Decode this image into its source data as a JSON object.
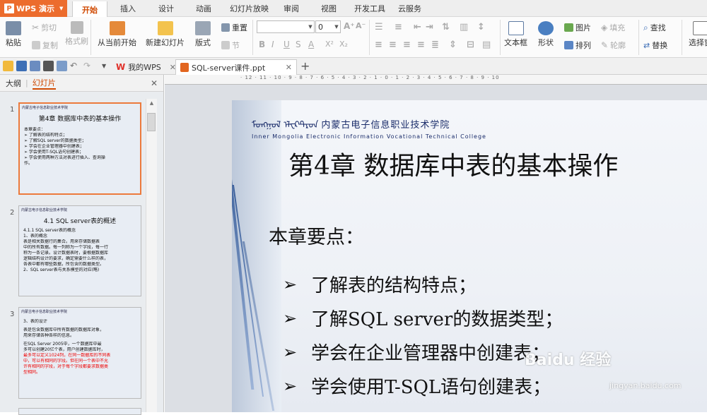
{
  "app": {
    "name": "WPS 演示",
    "accent": "#ec6c2d"
  },
  "menu": {
    "tabs": [
      "开始",
      "插入",
      "设计",
      "动画",
      "幻灯片放映",
      "审阅",
      "视图",
      "开发工具",
      "云服务"
    ],
    "active": "开始"
  },
  "ribbon": {
    "paste": "粘贴",
    "cut": "剪切",
    "copy": "复制",
    "format_painter": "格式刷",
    "from_current": "从当前开始",
    "new_slide": "新建幻灯片",
    "layout": "版式",
    "reset": "重置",
    "section": "节",
    "font_name": "",
    "font_size": "0",
    "textbox": "文本框",
    "shape": "形状",
    "picture": "图片",
    "fill": "填充",
    "arrange": "排列",
    "outline": "轮廓",
    "find": "查找",
    "replace": "替换",
    "select_pane": "选择窗"
  },
  "doc_tabs": [
    {
      "label": "我的WPS",
      "icon": "wps-home-icon"
    },
    {
      "label": "SQL-server课件.ppt",
      "icon": "ppt-file-icon"
    }
  ],
  "panel": {
    "outline_tab": "大纲",
    "slides_tab": "幻灯片"
  },
  "ruler": "· 12 · 11 · 10 · 9 · 8 · 7 · 6 · 5 · 4 · 3 · 2 · 1 · 0 · 1 · 2 · 3 · 4 · 5 · 6 · 7 · 8 · 9 · 10",
  "thumbs": [
    {
      "num": "1",
      "band": "内蒙古电子信息职业技术学院",
      "title": "第4章  数据库中表的基本操作",
      "lines": [
        {
          "t": "本章要点：",
          "red": false
        },
        {
          "t": "➢ 了解表的结构特点；",
          "red": false
        },
        {
          "t": "➢ 了解SQL server的数据类型；",
          "red": false
        },
        {
          "t": "➢ 学会在企业管理器中创建表；",
          "red": false
        },
        {
          "t": "➢ 学会使用T-SQL语句创建表；",
          "red": false
        },
        {
          "t": "➢ 学会使用两种方法对表进行插入、查询操",
          "red": false
        },
        {
          "t": "  作。",
          "red": false
        }
      ]
    },
    {
      "num": "2",
      "band": "内蒙古电子信息职业技术学院",
      "title": "4.1  SQL server表的概述",
      "lines": [
        {
          "t": "4.1.1 SQL server表的概念",
          "red": false
        },
        {
          "t": "1、表的概念",
          "red": false
        },
        {
          "t": "    表是相关数据行的集合。用来存储数据表",
          "red": false
        },
        {
          "t": "中的所有数据。每一列称为一个字段，每一行",
          "red": false
        },
        {
          "t": "称为一条记录。设计数据表时，要根据数据库",
          "red": false
        },
        {
          "t": "逻辑结构设计的要求，确定需要什么样的表，",
          "red": false
        },
        {
          "t": "各表中都有哪些数据，所包含的数据类型。",
          "red": false
        },
        {
          "t": "2、SQL server表与关系模型的对应(略)",
          "red": false
        }
      ]
    },
    {
      "num": "3",
      "band": "内蒙古电子信息职业技术学院",
      "title": "",
      "lines": [
        {
          "t": "3、表的设计",
          "red": false
        },
        {
          "t": "    表是包含数据库中所有数据的数据库对象，",
          "red": false
        },
        {
          "t": "用来存储各种各样的信息。",
          "red": false
        },
        {
          "t": "    在SQL Server 2005中，一个数据库中最",
          "red": false
        },
        {
          "t": "多可以创建20亿个表，用户创建数据库时，",
          "red": false
        },
        {
          "t": "最多可以定义1024列，在同一数据库的不同表",
          "red": true
        },
        {
          "t": "中，可以有相同的字段。但在同一个表中不允",
          "red": true
        },
        {
          "t": "许有相同的字段，对于每个字段都要求数据类",
          "red": true
        },
        {
          "t": "型相同。",
          "red": true
        }
      ]
    }
  ],
  "slide": {
    "college_cn": "ᠮᠣᠩᠭᠣᠯ ᠡᠯᠧᠺᠲ᠋ᠷᠣᠨ 内蒙古电子信息职业技术学院",
    "college_en": "Inner Mongolia Electronic Information Vocational Technical College",
    "title": "第4章  数据库中表的基本操作",
    "subtitle": "本章要点：",
    "bullets": [
      "了解表的结构特点；",
      "了解SQL server的数据类型；",
      "学会在企业管理器中创建表；",
      "学会使用T-SQL语句创建表；"
    ],
    "bullet_marker": "➢"
  },
  "watermark": {
    "text": "Baidu 经验",
    "sub": "jingyan.baidu.com"
  }
}
